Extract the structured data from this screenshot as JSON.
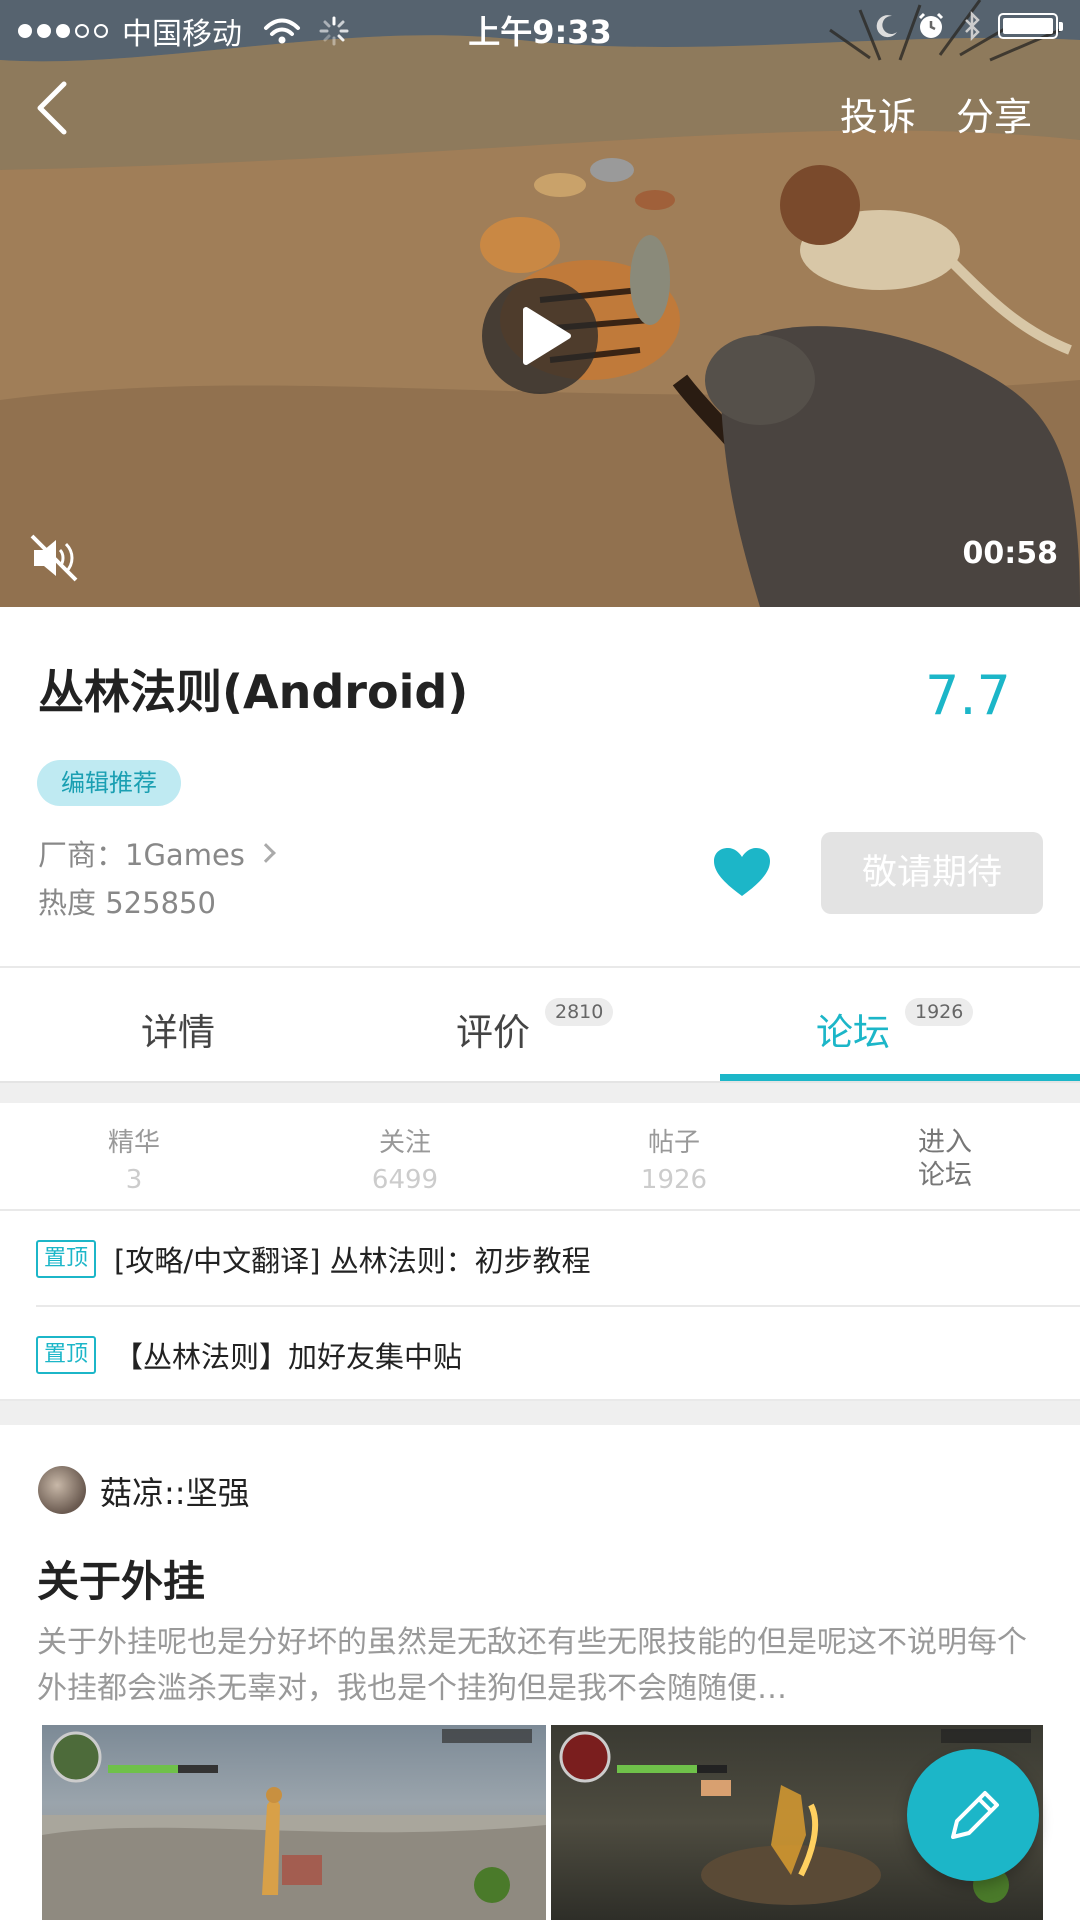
{
  "status_bar": {
    "carrier": "中国移动",
    "time": "上午9:33"
  },
  "hero": {
    "complaint_label": "投诉",
    "share_label": "分享",
    "duration": "00:58"
  },
  "game": {
    "title": "丛林法则(Android)",
    "rating": "7.7",
    "tag": "编辑推荐",
    "vendor": "厂商：1Games",
    "heat": "热度 525850",
    "expect_label": "敬请期待"
  },
  "tabs": [
    {
      "label": "详情",
      "count": ""
    },
    {
      "label": "评价",
      "count": "2810"
    },
    {
      "label": "论坛",
      "count": "1926"
    }
  ],
  "active_tab": "论坛",
  "forum_stats": [
    {
      "label": "精华",
      "value": "3"
    },
    {
      "label": "关注",
      "value": "6499"
    },
    {
      "label": "帖子",
      "value": "1926"
    }
  ],
  "enter_forum": {
    "line1": "进入",
    "line2": "论坛"
  },
  "pinned": [
    {
      "badge": "置顶",
      "title": "[攻略/中文翻译] 丛林法则：初步教程"
    },
    {
      "badge": "置顶",
      "title": "【丛林法则】加好友集中贴"
    }
  ],
  "post": {
    "author": "菇凉::坚强",
    "title": "关于外挂",
    "excerpt": "关于外挂呢也是分好坏的虽然是无敌还有些无限技能的但是呢这不说明每个外挂都会滥杀无辜对，我也是个挂狗但是我不会随随便…"
  },
  "colors": {
    "accent": "#1cb6c8",
    "tag_bg": "#bfeaf2",
    "disabled_button": "#e3e3e3"
  },
  "icons": {
    "back": "chevron-left-icon",
    "play": "play-icon",
    "mute": "speaker-muted-icon",
    "favorite": "heart-icon",
    "compose": "pencil-icon"
  }
}
